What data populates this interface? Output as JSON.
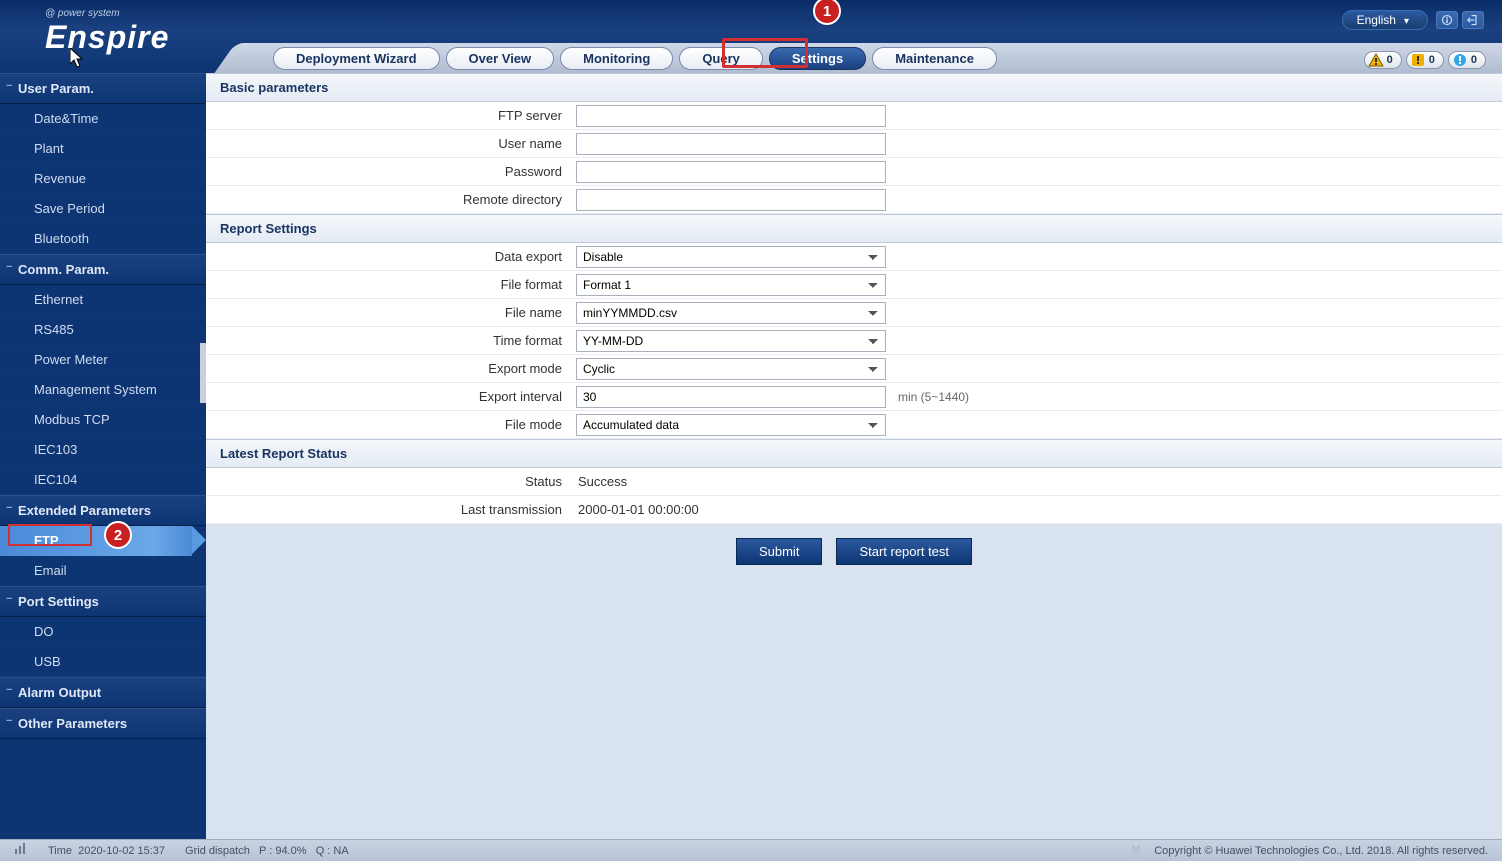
{
  "brand": {
    "tagline": "@ power system",
    "name": "Enspire"
  },
  "language": "English",
  "tabs": [
    "Deployment Wizard",
    "Over View",
    "Monitoring",
    "Query",
    "Settings",
    "Maintenance"
  ],
  "active_tab": "Settings",
  "alarm_badges": {
    "major": "0",
    "minor": "0",
    "warning": "0"
  },
  "callouts": {
    "tab": "1",
    "sidebar": "2"
  },
  "sidebar": {
    "groups": [
      {
        "title": "User Param.",
        "items": [
          "Date&Time",
          "Plant",
          "Revenue",
          "Save Period",
          "Bluetooth"
        ]
      },
      {
        "title": "Comm. Param.",
        "items": [
          "Ethernet",
          "RS485",
          "Power Meter",
          "Management System",
          "Modbus TCP",
          "IEC103",
          "IEC104"
        ]
      },
      {
        "title": "Extended Parameters",
        "items": [
          "FTP",
          "Email"
        ]
      },
      {
        "title": "Port Settings",
        "items": [
          "DO",
          "USB"
        ]
      },
      {
        "title": "Alarm Output",
        "items": []
      },
      {
        "title": "Other Parameters",
        "items": []
      }
    ],
    "active_item": "FTP"
  },
  "sections": {
    "basic": {
      "title": "Basic parameters",
      "fields": {
        "ftp_server": {
          "label": "FTP server",
          "value": ""
        },
        "user_name": {
          "label": "User name",
          "value": ""
        },
        "password": {
          "label": "Password",
          "value": ""
        },
        "remote_directory": {
          "label": "Remote directory",
          "value": ""
        }
      }
    },
    "report": {
      "title": "Report Settings",
      "fields": {
        "data_export": {
          "label": "Data export",
          "value": "Disable"
        },
        "file_format": {
          "label": "File format",
          "value": "Format 1"
        },
        "file_name": {
          "label": "File name",
          "value": "minYYMMDD.csv"
        },
        "time_format": {
          "label": "Time format",
          "value": "YY-MM-DD"
        },
        "export_mode": {
          "label": "Export mode",
          "value": "Cyclic"
        },
        "export_interval": {
          "label": "Export interval",
          "value": "30",
          "hint": "min (5~1440)"
        },
        "file_mode": {
          "label": "File mode",
          "value": "Accumulated data"
        }
      }
    },
    "status": {
      "title": "Latest Report Status",
      "fields": {
        "status": {
          "label": "Status",
          "value": "Success"
        },
        "last_tx": {
          "label": "Last transmission",
          "value": "2000-01-01 00:00:00"
        }
      }
    }
  },
  "buttons": {
    "submit": "Submit",
    "start_test": "Start report test"
  },
  "footer": {
    "time_label": "Time",
    "time_value": "2020-10-02 15:37",
    "dispatch_label": "Grid dispatch",
    "p_label": "P : 94.0%",
    "q_label": "Q : NA",
    "copyright": "Copyright © Huawei Technologies Co., Ltd. 2018. All rights reserved."
  }
}
